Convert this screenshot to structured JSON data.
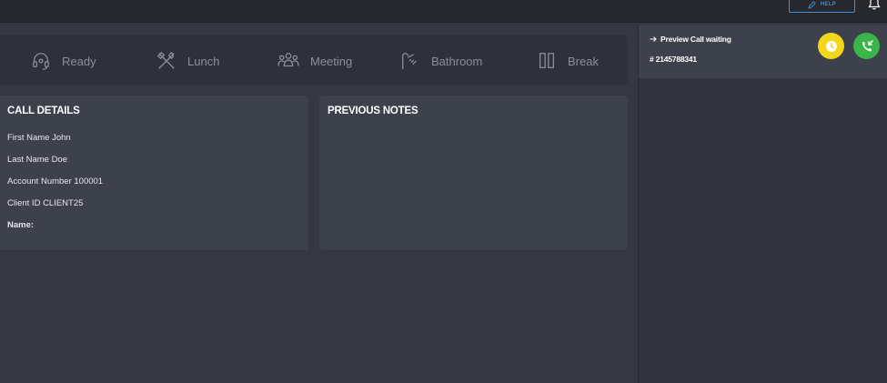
{
  "header": {
    "help_label": "HELP",
    "help_icon": "pen-icon",
    "bell_icon": "bell-icon"
  },
  "status_bar": {
    "items": [
      {
        "label": "Ready",
        "icon": "headset-icon"
      },
      {
        "label": "Lunch",
        "icon": "utensils-icon"
      },
      {
        "label": "Meeting",
        "icon": "users-icon"
      },
      {
        "label": "Bathroom",
        "icon": "shower-icon"
      },
      {
        "label": "Break",
        "icon": "pause-icon"
      }
    ]
  },
  "call_details": {
    "title": "CALL DETAILS",
    "fields": [
      {
        "text": "First Name John"
      },
      {
        "text": "Last Name Doe"
      },
      {
        "text": "Account Number 100001"
      },
      {
        "text": "Client ID CLIENT25"
      },
      {
        "text": "Name:"
      }
    ]
  },
  "previous_notes": {
    "title": "PREVIOUS NOTES"
  },
  "side_panel": {
    "preview_label": "Preview Call waiting",
    "phone_number": "# 2145788341",
    "colors": {
      "clock_button": "#f2d61a",
      "call_button": "#39b54a",
      "help_accent": "#3d8fd8"
    }
  }
}
